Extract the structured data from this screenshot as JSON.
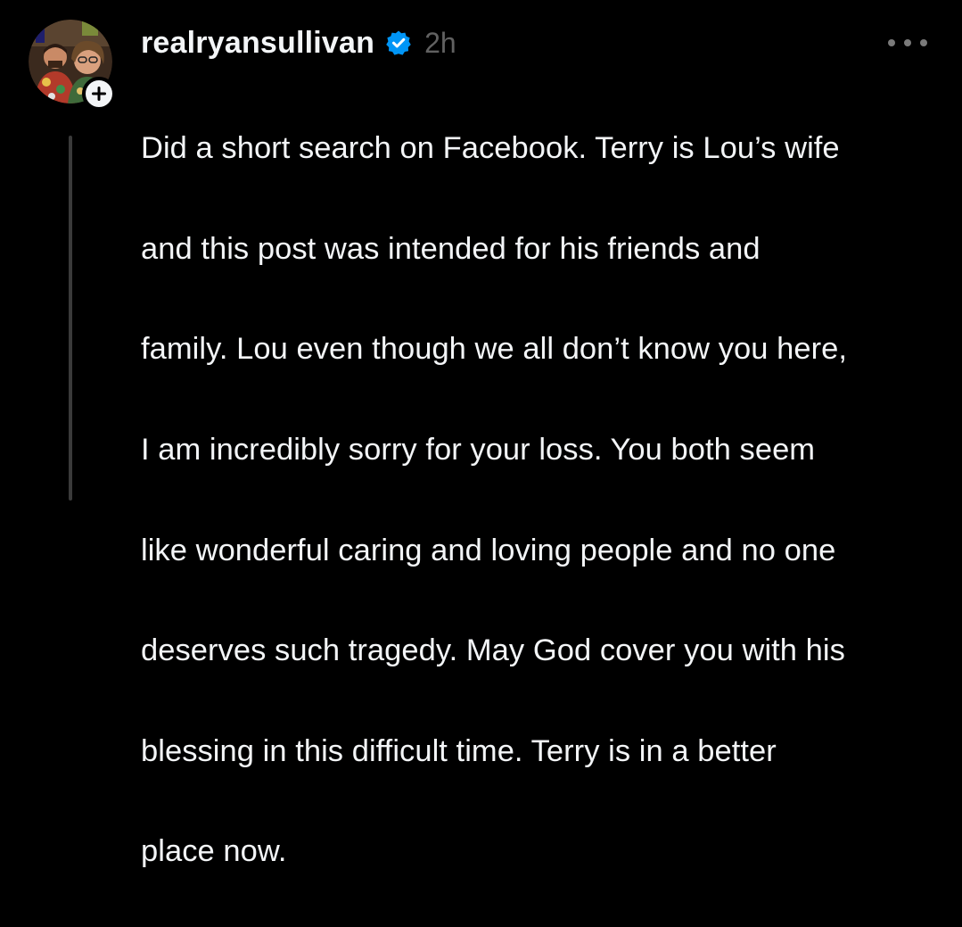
{
  "post": {
    "username": "realryansullivan",
    "verified": true,
    "timestamp": "2h",
    "body_lines": [
      "Did a short search on Facebook. Terry is Lou’s wife",
      "and this post was intended for his friends and",
      "family. Lou even though we all don’t know you here,",
      "I am incredibly sorry for your loss. You both seem",
      "like wonderful caring and loving people and no one",
      "deserves such tragedy. May God cover you with his",
      "blessing in this difficult time. Terry is in a better",
      "place now."
    ]
  },
  "icons": {
    "verified": "verified-badge-icon",
    "follow": "plus-icon",
    "more": "more-horizontal-icon"
  },
  "colors": {
    "background": "#000000",
    "text": "#f3f5f7",
    "muted": "#616161",
    "verified_blue": "#0095f6",
    "thread_line": "#3a3a3a"
  }
}
